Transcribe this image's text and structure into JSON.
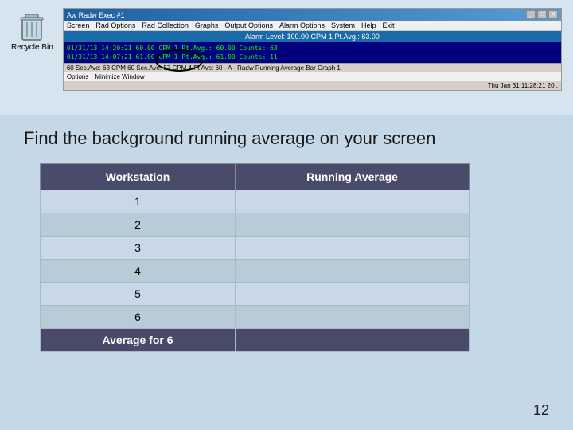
{
  "screenshot": {
    "title": "Aw Radw Exec #1",
    "menubar": [
      "Screen",
      "Rad Options",
      "Rad Collection",
      "Graphs",
      "Output Options",
      "Alarm Options",
      "System",
      "Help",
      "Exit"
    ],
    "alarm_bar": "Alarm Level: 100.00 CPM 1 Pt.Avg.: 63.00",
    "data_line1": "01/31/13 14:20:21  60.00 CPM 1 Pt.Avg.: 60.00 Counts: 63",
    "data_line2": "01/31/13 14:07:21  61.00 CPM 1 Pt.Avg.: 61.00 Counts: 11",
    "status_bar": "60 Sec.Ave: 63 CPM  60 Sec.Ave: 57 CPM  4 Pt Ave: 60 - A - Radw Running Average Bar Graph 1",
    "options_label": "Options    Minimize Window",
    "timestamp": "Thu Jan 31 11:28:21 20..",
    "controls": [
      "_",
      "□",
      "X"
    ]
  },
  "heading": "Find the background running average on your screen",
  "table": {
    "col1_header": "Workstation",
    "col2_header": "Running Average",
    "rows": [
      {
        "workstation": "1",
        "running_average": ""
      },
      {
        "workstation": "2",
        "running_average": ""
      },
      {
        "workstation": "3",
        "running_average": ""
      },
      {
        "workstation": "4",
        "running_average": ""
      },
      {
        "workstation": "5",
        "running_average": ""
      },
      {
        "workstation": "6",
        "running_average": ""
      }
    ],
    "footer_label": "Average for 6",
    "footer_value": ""
  },
  "page_number": "12"
}
